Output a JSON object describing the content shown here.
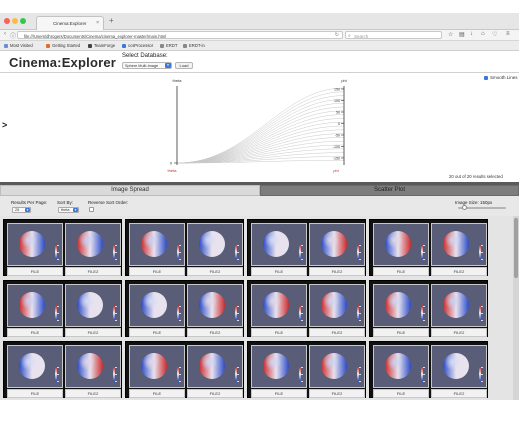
{
  "browser": {
    "tab_title": "Cinema:Explorer",
    "url": "file:///Users/dhrogers/Documents/Cinema/cinema_explorer-master/main.html",
    "search_placeholder": "Search",
    "bookmarks": [
      "Most Visited",
      "Getting Started",
      "TeamForge",
      "ccsProcessor",
      "ERDT",
      "ERDT-in"
    ]
  },
  "app": {
    "title": "Cinema:Explorer",
    "db_label": "Select Database:",
    "db_selected": "Sphere Multi-Image",
    "load_label": "Load"
  },
  "pcoord": {
    "axis_left_label": "theta",
    "axis_right_label": "phi",
    "axis_left_bottom": "0",
    "left_bottom_label": "theta",
    "right_bottom_label": "phi",
    "right_ticks": [
      "150",
      "100",
      "50",
      "0",
      "-50",
      "-100",
      "-150"
    ],
    "smooth_label": "Smooth Lines",
    "smooth_checked": true,
    "selected_count": "20 out of 20 results selected",
    "expand_arrow": ">"
  },
  "tabs": {
    "image_spread": "Image Spread",
    "scatter_plot": "Scatter Plot",
    "active": "image_spread"
  },
  "controls": {
    "results_per_page_label": "Results Per Page:",
    "results_per_page_value": "25",
    "sort_by_label": "Sort By:",
    "sort_by_value": "theta",
    "reverse_sort_label": "Reverse Sort Order:",
    "reverse_sort_checked": false,
    "image_size_label": "Image Size: 150px",
    "image_size_value": 150
  },
  "grid": {
    "file_labels": [
      "FILE",
      "FILE2"
    ],
    "colors": {
      "background": "#5a5d78",
      "positive": "#cc2b2b",
      "negative": "#2b4cc8"
    }
  }
}
